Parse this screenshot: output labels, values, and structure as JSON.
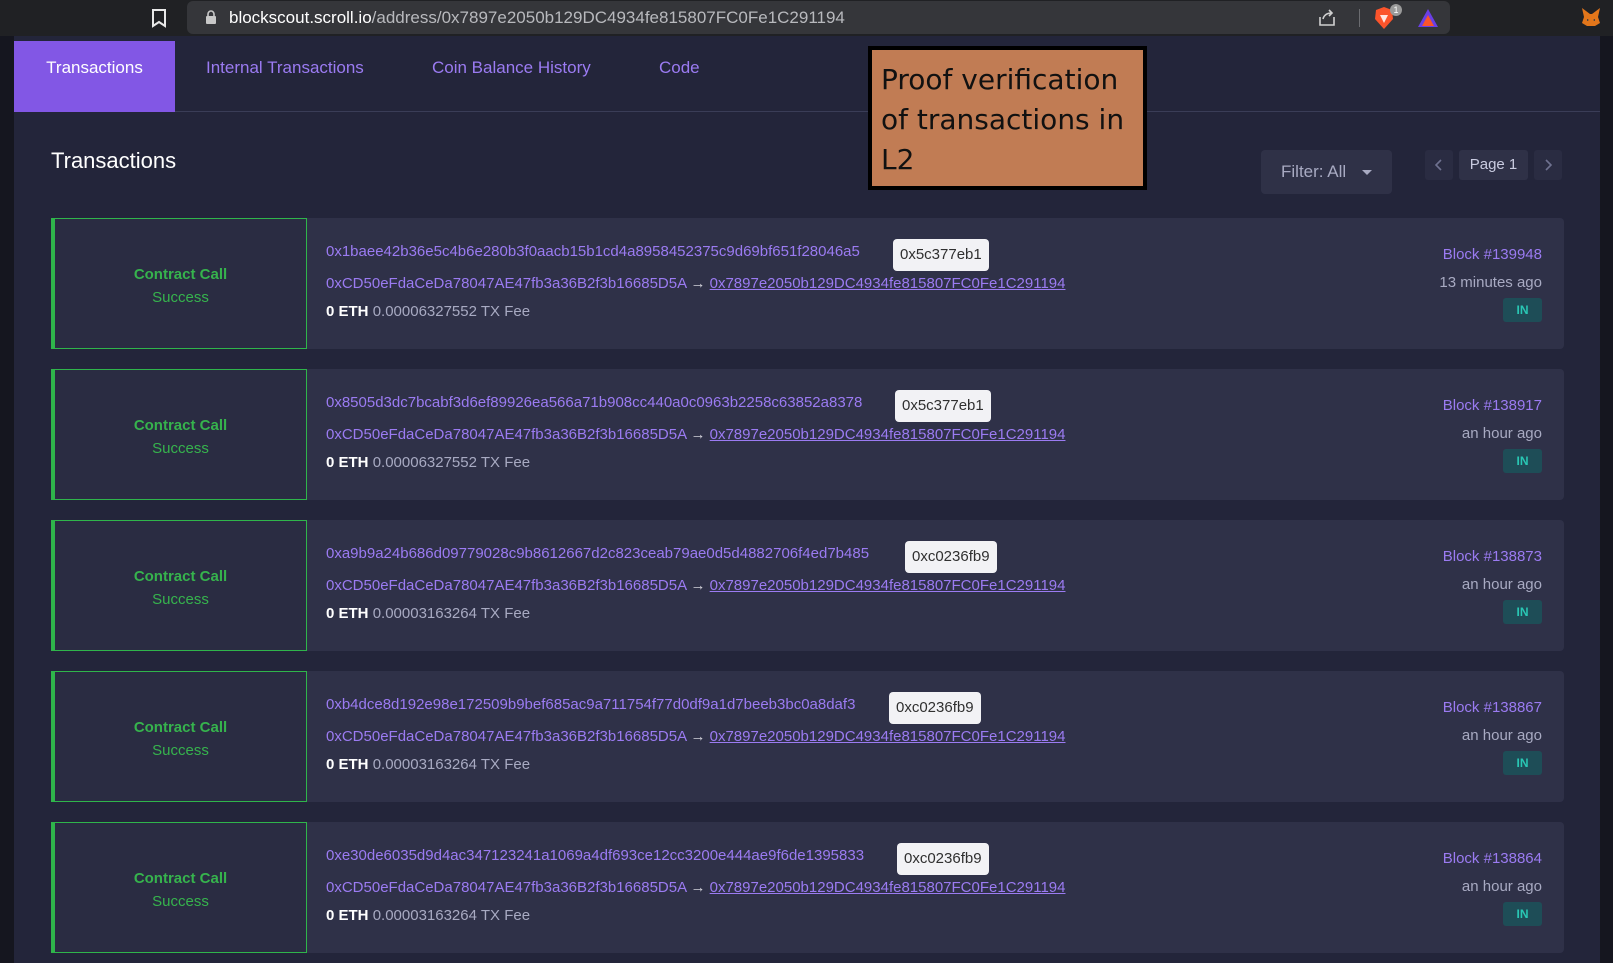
{
  "browser": {
    "url_host": "blockscout.scroll.io",
    "url_path": "/address/0x7897e2050b129DC4934fe815807FC0Fe1C291194",
    "brave_badge": "1"
  },
  "tabs": [
    {
      "label": "Transactions",
      "active": true
    },
    {
      "label": "Internal Transactions",
      "active": false
    },
    {
      "label": "Coin Balance History",
      "active": false
    },
    {
      "label": "Code",
      "active": false
    }
  ],
  "annotation": {
    "text": "Proof verification of transactions in L2"
  },
  "transactions_card": {
    "title": "Transactions",
    "filter_label": "Filter: All",
    "page_label": "Page 1"
  },
  "transactions": [
    {
      "type": "Contract Call",
      "result": "Success",
      "hash": "0x1baee42b36e5c4b6e280b3f0aacb15b1cd4a8958452375c9d69bf651f28046a5",
      "method": "0x5c377eb1",
      "from": "0xCD50eFdaCeDa78047AE47fb3a36B2f3b16685D5A",
      "arrow": "→",
      "to": "0x7897e2050b129DC4934fe815807FC0Fe1C291194",
      "amount": "0 ETH",
      "fee": "0.00006327552 TX Fee",
      "block": "Block #139948",
      "time": "13 minutes ago",
      "direction": "IN"
    },
    {
      "type": "Contract Call",
      "result": "Success",
      "hash": "0x8505d3dc7bcabf3d6ef89926ea566a71b908cc440a0c0963b2258c63852a8378",
      "method": "0x5c377eb1",
      "from": "0xCD50eFdaCeDa78047AE47fb3a36B2f3b16685D5A",
      "arrow": "→",
      "to": "0x7897e2050b129DC4934fe815807FC0Fe1C291194",
      "amount": "0 ETH",
      "fee": "0.00006327552 TX Fee",
      "block": "Block #138917",
      "time": "an hour ago",
      "direction": "IN"
    },
    {
      "type": "Contract Call",
      "result": "Success",
      "hash": "0xa9b9a24b686d09779028c9b8612667d2c823ceab79ae0d5d4882706f4ed7b485",
      "method": "0xc0236fb9",
      "from": "0xCD50eFdaCeDa78047AE47fb3a36B2f3b16685D5A",
      "arrow": "→",
      "to": "0x7897e2050b129DC4934fe815807FC0Fe1C291194",
      "amount": "0 ETH",
      "fee": "0.00003163264 TX Fee",
      "block": "Block #138873",
      "time": "an hour ago",
      "direction": "IN"
    },
    {
      "type": "Contract Call",
      "result": "Success",
      "hash": "0xb4dce8d192e98e172509b9bef685ac9a711754f77d0df9a1d7beeb3bc0a8daf3",
      "method": "0xc0236fb9",
      "from": "0xCD50eFdaCeDa78047AE47fb3a36B2f3b16685D5A",
      "arrow": "→",
      "to": "0x7897e2050b129DC4934fe815807FC0Fe1C291194",
      "amount": "0 ETH",
      "fee": "0.00003163264 TX Fee",
      "block": "Block #138867",
      "time": "an hour ago",
      "direction": "IN"
    },
    {
      "type": "Contract Call",
      "result": "Success",
      "hash": "0xe30de6035d9d4ac347123241a1069a4df693ce12cc3200e444ae9f6de1395833",
      "method": "0xc0236fb9",
      "from": "0xCD50eFdaCeDa78047AE47fb3a36B2f3b16685D5A",
      "arrow": "→",
      "to": "0x7897e2050b129DC4934fe815807FC0Fe1C291194",
      "amount": "0 ETH",
      "fee": "0.00003163264 TX Fee",
      "block": "Block #138864",
      "time": "an hour ago",
      "direction": "IN"
    }
  ],
  "colors": {
    "accent": "#8257e5",
    "link": "#9b7bf2",
    "success": "#36b34d",
    "in_badge": "#29c7b4"
  }
}
